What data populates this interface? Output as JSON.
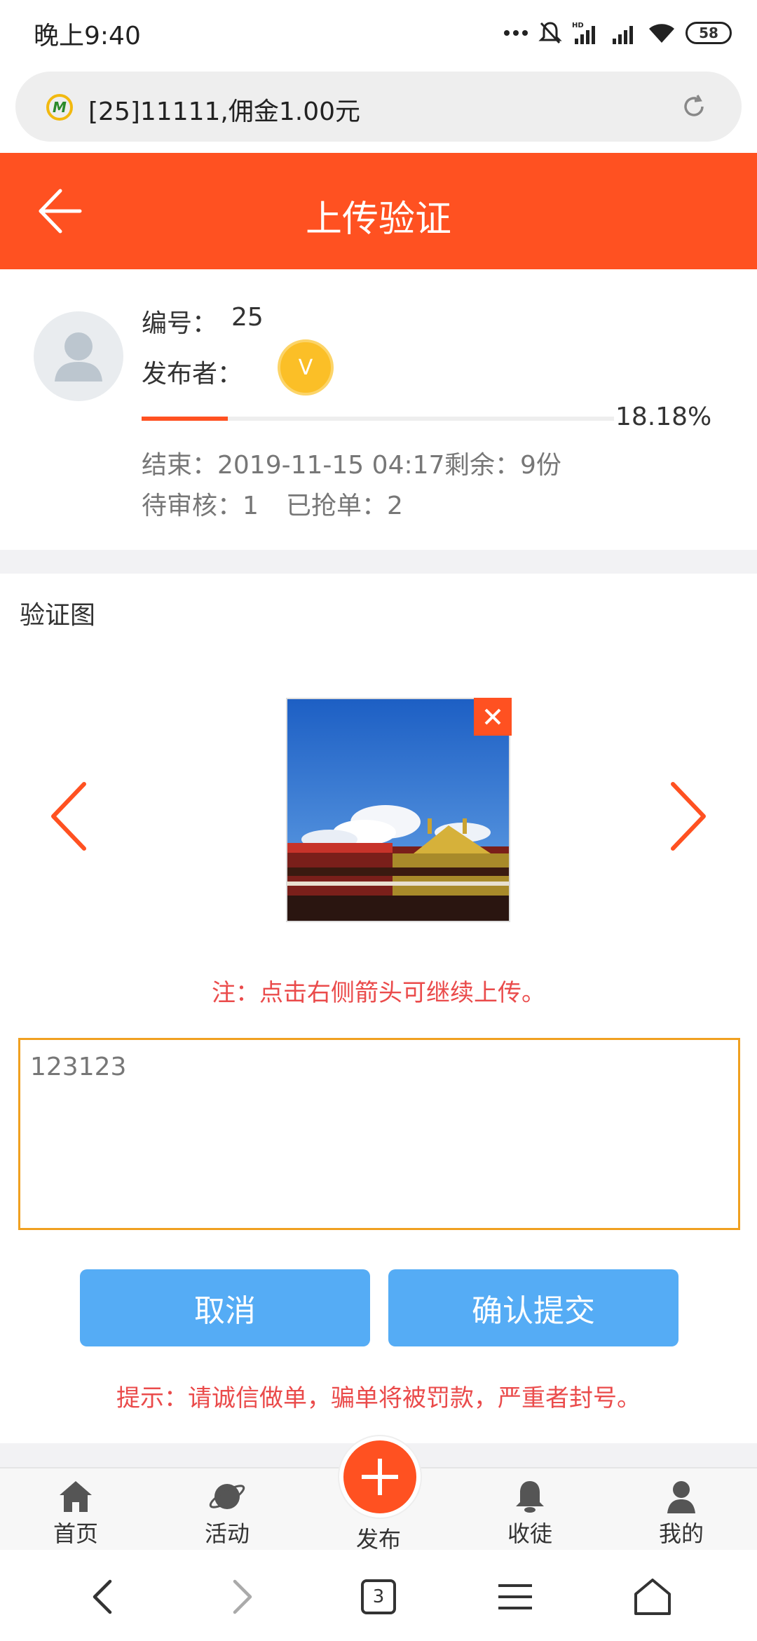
{
  "status_bar": {
    "time": "晚上9:40",
    "battery": "58",
    "network": "HD"
  },
  "url_bar": {
    "text": "[25]11111,佣金1.00元"
  },
  "header": {
    "title": "上传验证"
  },
  "task": {
    "id_label": "编号：",
    "id_value": "25",
    "publisher_label": "发布者：",
    "vip_badge": "V",
    "progress_pct": "18.18%",
    "progress_value": 18.18,
    "end_text": "结束：2019-11-15 04:17",
    "remaining_text": "剩余：9份",
    "pending_text": "待审核：1",
    "grabbed_text": "已抢单：2"
  },
  "verify": {
    "title": "验证图",
    "note": "注：点击右侧箭头可继续上传。",
    "input_value": "123123",
    "cancel_label": "取消",
    "submit_label": "确认提交",
    "tip": "提示：请诚信做单，骗单将被罚款，严重者封号。"
  },
  "bottom_nav": {
    "items": [
      {
        "label": "首页",
        "icon": "home-icon"
      },
      {
        "label": "活动",
        "icon": "planet-icon"
      },
      {
        "label": "发布",
        "icon": "plus-icon"
      },
      {
        "label": "收徒",
        "icon": "bell-icon"
      },
      {
        "label": "我的",
        "icon": "user-icon"
      }
    ]
  },
  "browser_nav": {
    "tab_count": "3"
  },
  "colors": {
    "accent": "#ff5121",
    "button": "#55acf5",
    "warning_text": "#ea4b4b",
    "input_border": "#f0a020"
  }
}
